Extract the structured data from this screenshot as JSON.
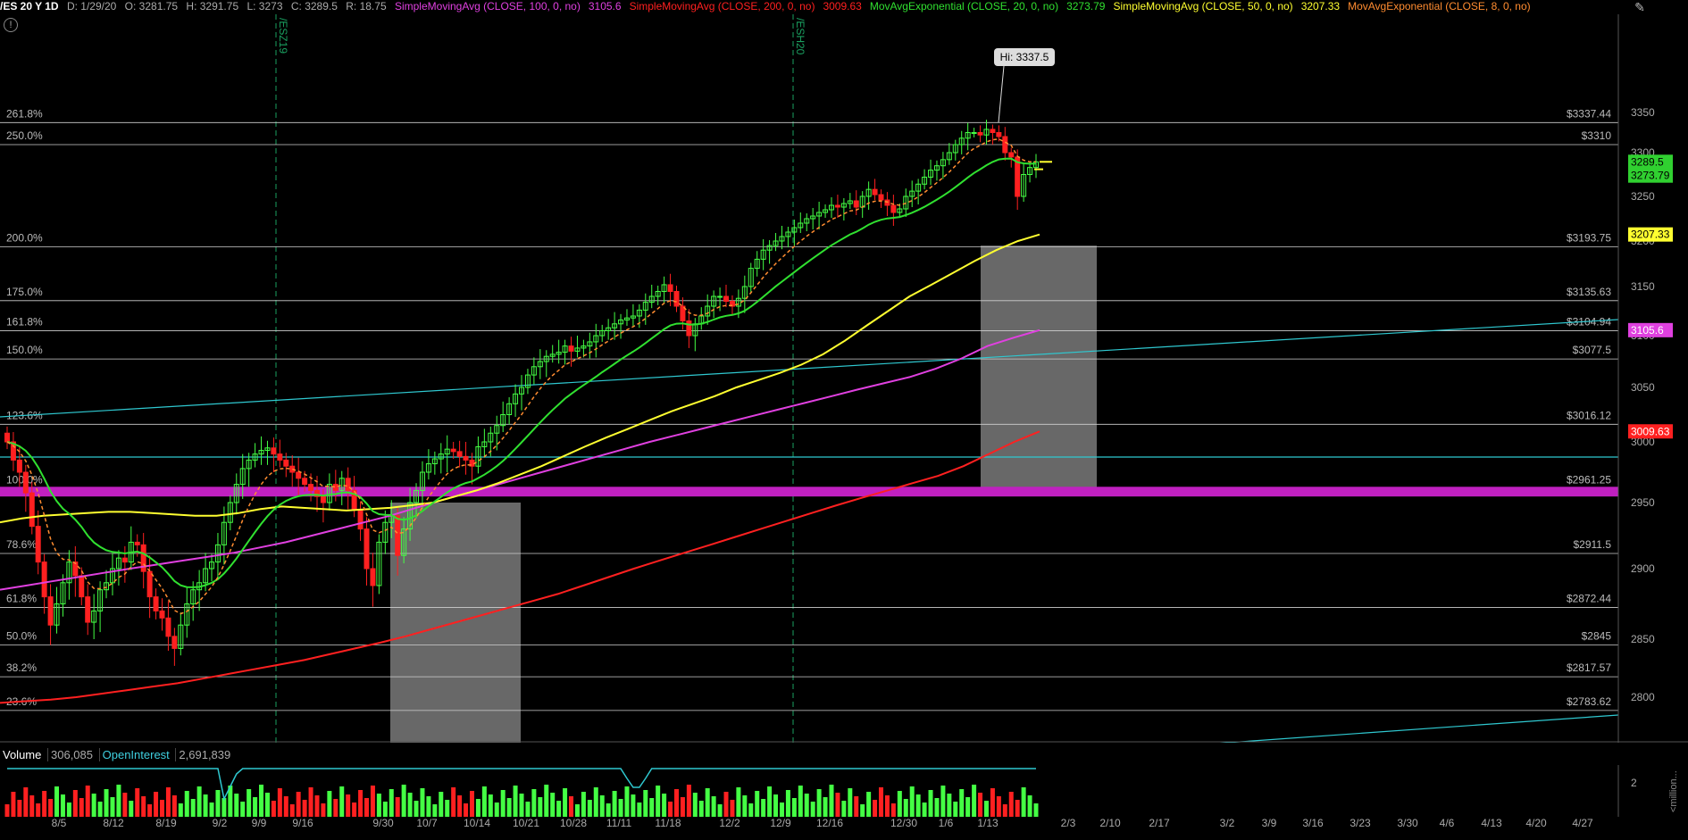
{
  "header": {
    "symbol": "/ES 20 Y 1D",
    "date": "D: 1/29/20",
    "open": "O: 3281.75",
    "high": "H: 3291.75",
    "low": "L: 3273",
    "close": "C: 3289.5",
    "range": "R: 18.75",
    "studies": [
      {
        "label": "SimpleMovingAvg (CLOSE, 100, 0, no)",
        "value": "3105.6",
        "color": "#e040e0"
      },
      {
        "label": "SimpleMovingAvg (CLOSE, 200, 0, no)",
        "value": "3009.63",
        "color": "#ff2020"
      },
      {
        "label": "MovAvgExponential (CLOSE, 20, 0, no)",
        "value": "3273.79",
        "color": "#30e030"
      },
      {
        "label": "SimpleMovingAvg (CLOSE, 50, 0, no)",
        "value": "3207.33",
        "color": "#ffff30"
      },
      {
        "label": "MovAvgExponential (CLOSE, 8, 0, no)",
        "value": "",
        "color": "#ff8c30"
      }
    ]
  },
  "contract_markers": [
    "/ESZ19",
    "/ESH20"
  ],
  "chart_data": {
    "type": "candlestick",
    "yaxis_ticks": [
      2800,
      2850,
      2900,
      2950,
      3000,
      3050,
      3100,
      3150,
      3200,
      3250,
      3300,
      3350
    ],
    "ylim": [
      2760,
      3370
    ],
    "high_label": "Hi: 3337.5",
    "fib_levels": [
      {
        "pct": "261.8%",
        "price": "$3337.44",
        "value": 3337.44
      },
      {
        "pct": "250.0%",
        "price": "$3310",
        "value": 3310
      },
      {
        "pct": "200.0%",
        "price": "$3193.75",
        "value": 3193.75
      },
      {
        "pct": "175.0%",
        "price": "$3135.63",
        "value": 3135.63
      },
      {
        "pct": "161.8%",
        "price": "$3104.94",
        "value": 3104.94
      },
      {
        "pct": "150.0%",
        "price": "$3077.5",
        "value": 3077.5
      },
      {
        "pct": "123.6%",
        "price": "$3016.12",
        "value": 3016.12
      },
      {
        "pct": "100.0%",
        "price": "$2961.25",
        "value": 2961.25
      },
      {
        "pct": "78.6%",
        "price": "$2911.5",
        "value": 2911.5
      },
      {
        "pct": "61.8%",
        "price": "$2872.44",
        "value": 2872.44
      },
      {
        "pct": "50.0%",
        "price": "$2845",
        "value": 2845
      },
      {
        "pct": "38.2%",
        "price": "$2817.57",
        "value": 2817.57
      },
      {
        "pct": "23.6%",
        "price": "$2783.62",
        "value": 2783.62
      }
    ],
    "price_badges": [
      {
        "text": "3289.5",
        "value": 3289.5,
        "bg": "#30d030",
        "fg": "#000"
      },
      {
        "text": "3273.79",
        "value": 3273.79,
        "bg": "#30d030",
        "fg": "#000"
      },
      {
        "text": "3207.33",
        "value": 3207.33,
        "bg": "#ffff30",
        "fg": "#000"
      },
      {
        "text": "3105.6",
        "value": 3105.6,
        "bg": "#e040e0",
        "fg": "#fff"
      },
      {
        "text": "3009.63",
        "value": 3009.63,
        "bg": "#ff2020",
        "fg": "#fff"
      }
    ],
    "closes": [
      3000,
      2985,
      2975,
      2958,
      2932,
      2905,
      2880,
      2860,
      2875,
      2890,
      2905,
      2895,
      2880,
      2862,
      2870,
      2885,
      2890,
      2900,
      2908,
      2905,
      2920,
      2918,
      2898,
      2880,
      2870,
      2865,
      2852,
      2842,
      2860,
      2875,
      2885,
      2890,
      2900,
      2905,
      2918,
      2935,
      2950,
      2965,
      2978,
      2985,
      2990,
      2993,
      2995,
      2990,
      2985,
      2980,
      2975,
      2970,
      2965,
      2960,
      2955,
      2950,
      2965,
      2960,
      2970,
      2960,
      2945,
      2930,
      2900,
      2888,
      2920,
      2935,
      2940,
      2910,
      2930,
      2950,
      2960,
      2975,
      2982,
      2986,
      2990,
      2994,
      2992,
      2988,
      2985,
      2980,
      2996,
      3000,
      3008,
      3015,
      3025,
      3035,
      3044,
      3050,
      3062,
      3070,
      3075,
      3080,
      3082,
      3084,
      3090,
      3085,
      3088,
      3090,
      3094,
      3100,
      3105,
      3108,
      3112,
      3116,
      3118,
      3120,
      3126,
      3134,
      3140,
      3145,
      3152,
      3145,
      3130,
      3115,
      3100,
      3112,
      3120,
      3130,
      3140,
      3140,
      3135,
      3130,
      3138,
      3150,
      3170,
      3180,
      3190,
      3195,
      3200,
      3205,
      3210,
      3215,
      3220,
      3225,
      3228,
      3232,
      3235,
      3240,
      3238,
      3242,
      3245,
      3238,
      3250,
      3258,
      3252,
      3246,
      3240,
      3232,
      3236,
      3250,
      3256,
      3264,
      3272,
      3280,
      3285,
      3292,
      3300,
      3310,
      3318,
      3325,
      3325,
      3322,
      3329,
      3325,
      3320,
      3300,
      3295,
      3250,
      3275,
      3283,
      3289.5
    ],
    "ma100": [
      2885,
      2888,
      2891,
      2894,
      2897,
      2900,
      2903,
      2906,
      2909,
      2912,
      2916,
      2920,
      2925,
      2930,
      2935,
      2940,
      2946,
      2952,
      2958,
      2964,
      2970,
      2976,
      2982,
      2988,
      2994,
      3000,
      3006,
      3012,
      3018,
      3024,
      3030,
      3036,
      3042,
      3048,
      3054,
      3060,
      3068,
      3078,
      3090,
      3098,
      3105.6
    ],
    "ma200": [
      2793,
      2795,
      2797,
      2800,
      2803,
      2806,
      2809,
      2812,
      2816,
      2820,
      2824,
      2828,
      2832,
      2837,
      2842,
      2847,
      2852,
      2857,
      2862,
      2867,
      2872,
      2877,
      2882,
      2888,
      2894,
      2900,
      2906,
      2912,
      2918,
      2924,
      2930,
      2936,
      2942,
      2948,
      2954,
      2960,
      2966,
      2972,
      2980,
      2990,
      3000,
      3009.63
    ],
    "ma50": [
      2935,
      2938,
      2940,
      2941,
      2942,
      2943,
      2943,
      2942,
      2941,
      2940,
      2940,
      2942,
      2945,
      2947,
      2946,
      2945,
      2944,
      2945,
      2946,
      2948,
      2950,
      2955,
      2960,
      2966,
      2973,
      2980,
      2988,
      2996,
      3004,
      3012,
      3020,
      3028,
      3035,
      3042,
      3050,
      3057,
      3064,
      3072,
      3082,
      3095,
      3110,
      3125,
      3140,
      3152,
      3165,
      3178,
      3190,
      3200,
      3207.33
    ],
    "volume_header": {
      "label": "Volume",
      "value": "306,085",
      "oi_label": "OpenInterest",
      "oi_value": "2,691,839"
    },
    "volume_axis_tick": "2",
    "volume_unit": "<million...",
    "x_tick_labels": [
      "8/5",
      "8/12",
      "8/19",
      "9/2",
      "9/9",
      "9/16",
      "9/30",
      "10/7",
      "10/14",
      "10/21",
      "10/28",
      "11/11",
      "11/18",
      "12/2",
      "12/9",
      "12/16",
      "12/30",
      "1/6",
      "1/13",
      "2/3",
      "2/10",
      "2/17",
      "3/2",
      "3/9",
      "3/16",
      "3/23",
      "3/30",
      "4/6",
      "4/13",
      "4/20",
      "4/27"
    ]
  }
}
